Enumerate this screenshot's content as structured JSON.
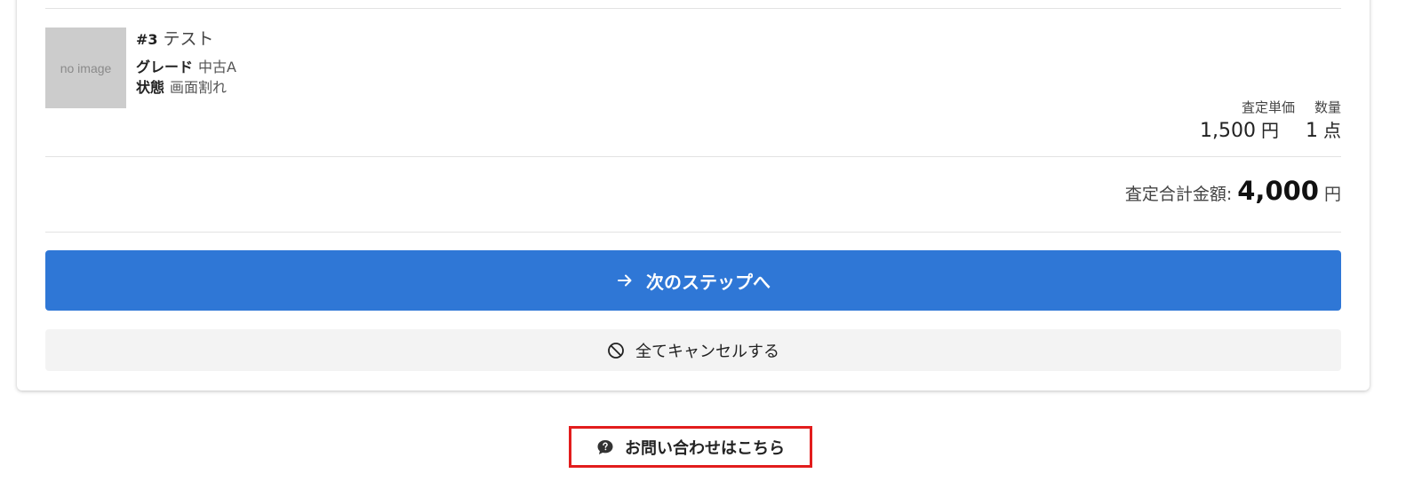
{
  "item": {
    "number": "#3",
    "name": "テスト",
    "thumbnail_text": "no image",
    "grade_label": "グレード",
    "grade_value": "中古A",
    "condition_label": "状態",
    "condition_value": "画面割れ",
    "unit_price_label": "査定単価",
    "quantity_label": "数量",
    "unit_price_value": "1,500",
    "unit_price_unit": "円",
    "quantity_value": "1",
    "quantity_unit": "点"
  },
  "total": {
    "label": "査定合計金額:",
    "amount": "4,000",
    "unit": "円"
  },
  "actions": {
    "next_label": "次のステップへ",
    "cancel_label": "全てキャンセルする",
    "contact_label": "お問い合わせはこちら"
  },
  "icons": {
    "next": "arrow-right-icon",
    "cancel": "ban-icon",
    "contact": "question-chat-icon"
  },
  "colors": {
    "primary": "#2f77d6",
    "highlight_border": "#e21d1d",
    "secondary_bg": "#f3f3f3"
  }
}
